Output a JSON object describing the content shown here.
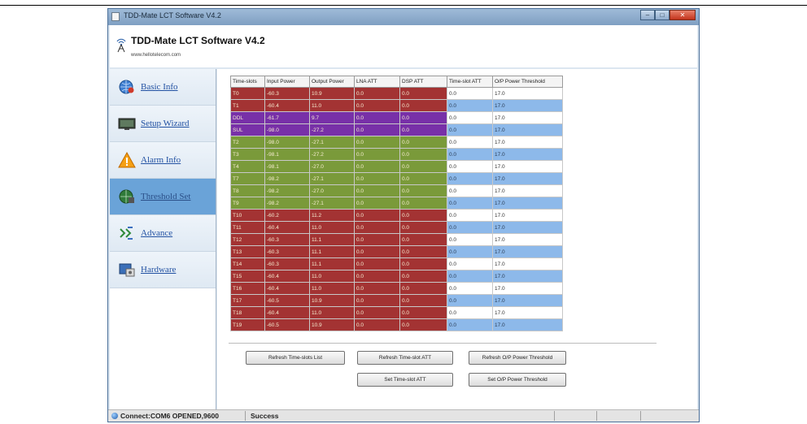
{
  "window": {
    "title": "TDD-Mate LCT Software V4.2",
    "buttons": [
      "‒",
      "□",
      "✕"
    ]
  },
  "header": {
    "app_name": "TDD-Mate LCT Software V4.2",
    "url": "www.hellotelecom.com"
  },
  "sidebar": {
    "items": [
      {
        "label": "Basic Info",
        "icon": "globe-icon",
        "active": false
      },
      {
        "label": "Setup Wizard",
        "icon": "monitor-icon",
        "active": false
      },
      {
        "label": "Alarm Info",
        "icon": "warning-icon",
        "active": false
      },
      {
        "label": "Threshold Set",
        "icon": "globe-settings-icon",
        "active": true
      },
      {
        "label": "Advance",
        "icon": "arrows-icon",
        "active": false
      },
      {
        "label": "Hardware",
        "icon": "hardware-icon",
        "active": false
      }
    ]
  },
  "table": {
    "headers": [
      "Time-slots",
      "Input Power",
      "Output Power",
      "LNA ATT",
      "DSP ATT",
      "Time-slot ATT",
      "O/P Power Threshold"
    ],
    "rows": [
      {
        "color": "red",
        "cells": [
          "T0",
          "-60.3",
          "10.9",
          "0.0",
          "0.0",
          "0.0",
          "17.0"
        ]
      },
      {
        "color": "red",
        "cells": [
          "T1",
          "-60.4",
          "11.0",
          "0.0",
          "0.0",
          "0.0",
          "17.0"
        ]
      },
      {
        "color": "purple",
        "cells": [
          "DDL",
          "-61.7",
          "9.7",
          "0.0",
          "0.0",
          "0.0",
          "17.0"
        ]
      },
      {
        "color": "purple",
        "cells": [
          "SUL",
          "-98.0",
          "-27.2",
          "0.0",
          "0.0",
          "0.0",
          "17.0"
        ]
      },
      {
        "color": "green",
        "cells": [
          "T2",
          "-98.0",
          "-27.1",
          "0.0",
          "0.0",
          "0.0",
          "17.0"
        ]
      },
      {
        "color": "green",
        "cells": [
          "T3",
          "-98.1",
          "-27.2",
          "0.0",
          "0.0",
          "0.0",
          "17.0"
        ]
      },
      {
        "color": "green",
        "cells": [
          "T4",
          "-98.1",
          "-27.0",
          "0.0",
          "0.0",
          "0.0",
          "17.0"
        ]
      },
      {
        "color": "green",
        "cells": [
          "T7",
          "-98.2",
          "-27.1",
          "0.0",
          "0.0",
          "0.0",
          "17.0"
        ]
      },
      {
        "color": "green",
        "cells": [
          "T8",
          "-98.2",
          "-27.0",
          "0.0",
          "0.0",
          "0.0",
          "17.0"
        ]
      },
      {
        "color": "green",
        "cells": [
          "T9",
          "-98.2",
          "-27.1",
          "0.0",
          "0.0",
          "0.0",
          "17.0"
        ]
      },
      {
        "color": "red",
        "cells": [
          "T10",
          "-60.2",
          "11.2",
          "0.0",
          "0.0",
          "0.0",
          "17.0"
        ]
      },
      {
        "color": "red",
        "cells": [
          "T11",
          "-60.4",
          "11.0",
          "0.0",
          "0.0",
          "0.0",
          "17.0"
        ]
      },
      {
        "color": "red",
        "cells": [
          "T12",
          "-60.3",
          "11.1",
          "0.0",
          "0.0",
          "0.0",
          "17.0"
        ]
      },
      {
        "color": "red",
        "cells": [
          "T13",
          "-60.3",
          "11.1",
          "0.0",
          "0.0",
          "0.0",
          "17.0"
        ]
      },
      {
        "color": "red",
        "cells": [
          "T14",
          "-60.3",
          "11.1",
          "0.0",
          "0.0",
          "0.0",
          "17.0"
        ]
      },
      {
        "color": "red",
        "cells": [
          "T15",
          "-60.4",
          "11.0",
          "0.0",
          "0.0",
          "0.0",
          "17.0"
        ]
      },
      {
        "color": "red",
        "cells": [
          "T16",
          "-60.4",
          "11.0",
          "0.0",
          "0.0",
          "0.0",
          "17.0"
        ]
      },
      {
        "color": "red",
        "cells": [
          "T17",
          "-60.5",
          "10.9",
          "0.0",
          "0.0",
          "0.0",
          "17.0"
        ]
      },
      {
        "color": "red",
        "cells": [
          "T18",
          "-60.4",
          "11.0",
          "0.0",
          "0.0",
          "0.0",
          "17.0"
        ]
      },
      {
        "color": "red",
        "cells": [
          "T19",
          "-60.5",
          "10.9",
          "0.0",
          "0.0",
          "0.0",
          "17.0"
        ]
      }
    ]
  },
  "buttons": {
    "refresh_slots": "Refresh Time-slots List",
    "refresh_att": "Refresh Time-slot ATT",
    "refresh_threshold": "Refresh O/P Power Threshold",
    "set_att": "Set Time-slot ATT",
    "set_threshold": "Set O/P Power Threshold"
  },
  "status": {
    "connection": "Connect:COM6 OPENED,9600",
    "message": "Success"
  },
  "colors": {
    "red_row": "#a33333",
    "purple_row": "#7830a8",
    "green_row": "#7a9a3a",
    "blue_row": "#8db9ea",
    "active_nav": "#6aa3d8"
  }
}
